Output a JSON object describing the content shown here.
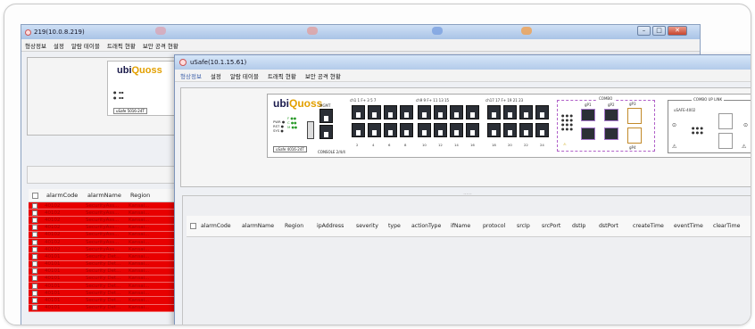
{
  "back_window": {
    "title": "219(10.0.8.219)",
    "menu": [
      "형상정보",
      "설정",
      "알람 테이블",
      "트래픽 현황",
      "보안 공격 현황"
    ],
    "logo_prefix": "ubi",
    "logo_suffix": "Quoss",
    "model_tag": "uSafe 5016-24T",
    "columns": [
      "alarmCode",
      "alarmName",
      "Region"
    ],
    "rows": [
      [
        "40102",
        "SecurityAss...",
        "Kansai..."
      ],
      [
        "40102",
        "SecurityAss...",
        "Kansai..."
      ],
      [
        "40102",
        "SecurityAss...",
        "Kansai..."
      ],
      [
        "40102",
        "SecurityAss...",
        "Kansai..."
      ],
      [
        "40102",
        "SecurityAss...",
        "Kansai..."
      ],
      [
        "40102",
        "SecurityAss...",
        "Kansai..."
      ],
      [
        "40102",
        "SecurityAss...",
        "Kansai..."
      ],
      [
        "40101",
        "Security Det...",
        "Kansai..."
      ],
      [
        "40101",
        "Security Det...",
        "Kansai..."
      ],
      [
        "40101",
        "Security Det...",
        "Kansai..."
      ],
      [
        "40101",
        "Security Det...",
        "Kansai..."
      ],
      [
        "40101",
        "Security Det...",
        "Kansai..."
      ],
      [
        "40101",
        "Security Det...",
        "Kansai..."
      ],
      [
        "40101",
        "Security Det...",
        "Kansai..."
      ],
      [
        "40101",
        "Security Det...",
        "Kansai..."
      ]
    ],
    "window_controls": [
      "–",
      "□",
      "✕"
    ]
  },
  "front_window": {
    "title": "uSafe(10.1.15.61)",
    "menu": [
      "형상정보",
      "설정",
      "알람 테이블",
      "트래픽 현황",
      "보안 공격 현황"
    ],
    "device": {
      "logo_prefix": "ubi",
      "logo_suffix": "Quoss",
      "model_tag": "uSafe 4016-24T",
      "console_label": "CONSOLE 2/4/4",
      "mgmt_label": "MGMT",
      "combo_label": "COMBO",
      "combo_uplink_label": "COMBO UP LINK",
      "uplink_model": "uSAFE-4002",
      "group_labels": [
        "ch1 1 F+ 3 5 7",
        "ch9 9 F+ 11 13 15",
        "ch17 17 F+ 19 21 23"
      ],
      "bottom_labels": [
        "2",
        "4",
        "6",
        "8",
        "10",
        "12",
        "14",
        "16",
        "18",
        "20",
        "22",
        "24"
      ],
      "sfp_labels": [
        "gP1",
        "gP2",
        "gP3",
        "gP4"
      ]
    },
    "splitter": "......",
    "columns": [
      "alarmCode",
      "alarmName",
      "Region",
      "ipAddress",
      "severity",
      "type",
      "actionType",
      "ifName",
      "protocol",
      "srcIp",
      "srcPort",
      "dstIp",
      "dstPort",
      "createTime",
      "eventTime",
      "clearTime"
    ]
  },
  "colors": {
    "alarm_row": "#e80000",
    "title_bar": "#b3cbea"
  }
}
